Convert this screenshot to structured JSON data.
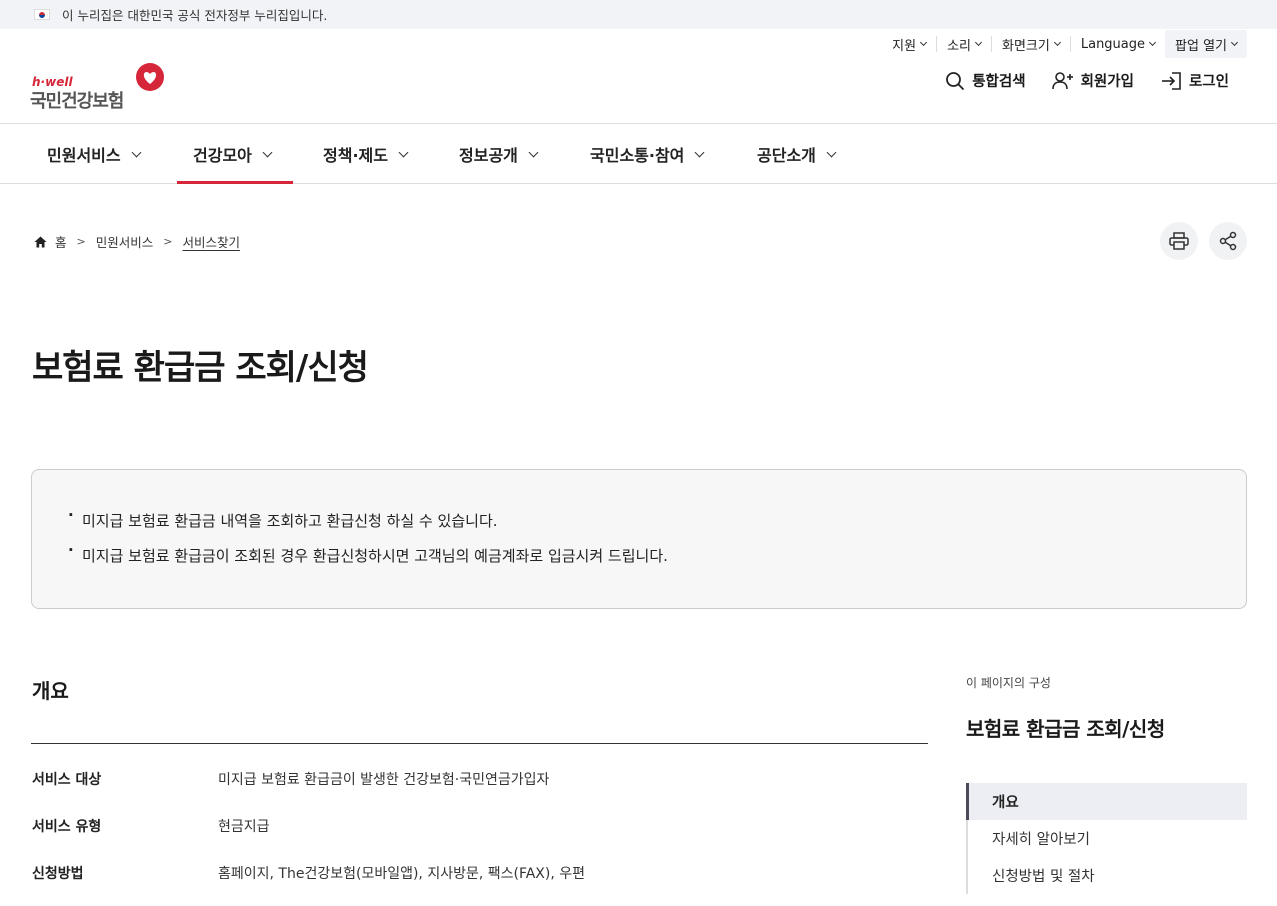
{
  "gov_banner": {
    "text": "이 누리집은 대한민국 공식 전자정부 누리집입니다."
  },
  "utility": [
    "지원",
    "소리",
    "화면크기",
    "Language",
    "팝업 열기"
  ],
  "logo": {
    "tagline": "h·well",
    "name": "국민건강보험"
  },
  "actions": {
    "search": "통합검색",
    "signup": "회원가입",
    "login": "로그인"
  },
  "gnb": [
    "민원서비스",
    "건강모아",
    "정책·제도",
    "정보공개",
    "국민소통·참여",
    "공단소개"
  ],
  "gnb_active": "건강모아",
  "breadcrumb": {
    "home": "홈",
    "level1": "민원서비스",
    "current": "서비스찾기"
  },
  "page_title": "보험료 환급금 조회/신청",
  "notice": [
    "미지급 보험료 환급금 내역을 조회하고 환급신청 하실 수 있습니다.",
    "미지급 보험료 환급금이 조회된 경우 환급신청하시면 고객님의 예금계좌로 입금시켜 드립니다."
  ],
  "overview": {
    "title": "개요",
    "rows": [
      {
        "key": "서비스 대상",
        "value": "미지급 보험료 환급금이 발생한 건강보험·국민연금가입자"
      },
      {
        "key": "서비스 유형",
        "value": "현금지급"
      },
      {
        "key": "신청방법",
        "value": "홈페이지, The건강보험(모바일앱), 지사방문, 팩스(FAX), 우편"
      }
    ]
  },
  "toc": {
    "caption": "이 페이지의 구성",
    "title": "보험료 환급금 조회/신청",
    "items": [
      "개요",
      "자세히 알아보기",
      "신청방법 및 절차"
    ]
  },
  "colors": {
    "accent": "#d5263a",
    "panel_bg": "#f7f7f7"
  }
}
